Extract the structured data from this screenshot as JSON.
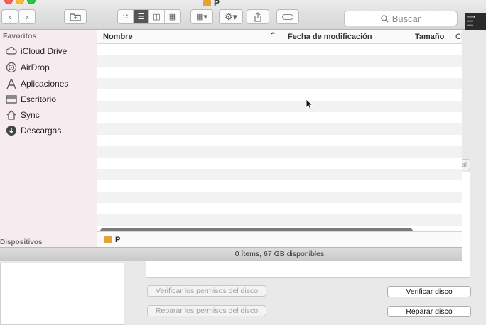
{
  "window": {
    "title": "P"
  },
  "toolbar": {
    "search_placeholder": "Buscar"
  },
  "sidebar": {
    "favorites_heading": "Favoritos",
    "devices_heading": "Dispositivos",
    "items": [
      {
        "label": "iCloud Drive",
        "icon": "cloud-icon"
      },
      {
        "label": "AirDrop",
        "icon": "airdrop-icon"
      },
      {
        "label": "Aplicaciones",
        "icon": "applications-icon"
      },
      {
        "label": "Escritorio",
        "icon": "desktop-icon"
      },
      {
        "label": "Sync",
        "icon": "home-icon"
      },
      {
        "label": "Descargas",
        "icon": "downloads-icon"
      }
    ]
  },
  "filelist": {
    "columns": [
      "Nombre",
      "Fecha de modificación",
      "Tamaño",
      "CRegistro"
    ]
  },
  "pathbar": {
    "item": "P"
  },
  "status": {
    "text": "0 ítems, 67 GB disponibles"
  },
  "background": {
    "buttons_disabled": [
      "Verificar los permisos del disco",
      "Reparar los permisos del disco"
    ],
    "buttons_enabled": [
      "Verificar disco",
      "Reparar disco"
    ],
    "partial_label": "al"
  },
  "colors": {
    "sidebar_bg": "#f6ecef",
    "row_alt": "#f2f2f2",
    "scrollbar": "#7b7b7b"
  }
}
